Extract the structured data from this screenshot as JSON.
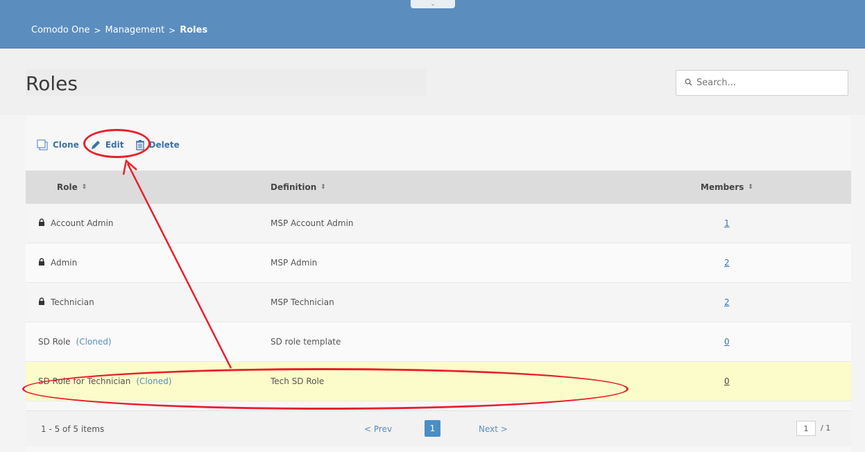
{
  "breadcrumb": {
    "items": [
      "Comodo One",
      "Management",
      "Roles"
    ],
    "separator": ">"
  },
  "page": {
    "title": "Roles"
  },
  "search": {
    "placeholder": "Search..."
  },
  "toolbar": {
    "clone_label": "Clone",
    "edit_label": "Edit",
    "delete_label": "Delete"
  },
  "table": {
    "headers": {
      "role": "Role",
      "definition": "Definition",
      "members": "Members"
    },
    "rows": [
      {
        "role": "Account Admin",
        "locked": true,
        "cloned_label": "",
        "definition": "MSP Account Admin",
        "members": "1"
      },
      {
        "role": "Admin",
        "locked": true,
        "cloned_label": "",
        "definition": "MSP Admin",
        "members": "2"
      },
      {
        "role": "Technician",
        "locked": true,
        "cloned_label": "",
        "definition": "MSP Technician",
        "members": "2"
      },
      {
        "role": "SD Role",
        "locked": false,
        "cloned_label": "(Cloned)",
        "definition": "SD role template",
        "members": "0"
      },
      {
        "role": "SD Role for Technician",
        "locked": false,
        "cloned_label": "(Cloned)",
        "definition": "Tech SD Role",
        "members": "0"
      }
    ]
  },
  "pager": {
    "info": "1 - 5 of 5 items",
    "prev": "< Prev",
    "current_page": "1",
    "next": "Next >",
    "page_input": "1",
    "total_pages": "/ 1"
  },
  "colors": {
    "header_blue": "#5b8dbf",
    "link_blue": "#3a72a8",
    "selected_row": "#fbfcc9",
    "annotation_red": "#e8202a"
  }
}
